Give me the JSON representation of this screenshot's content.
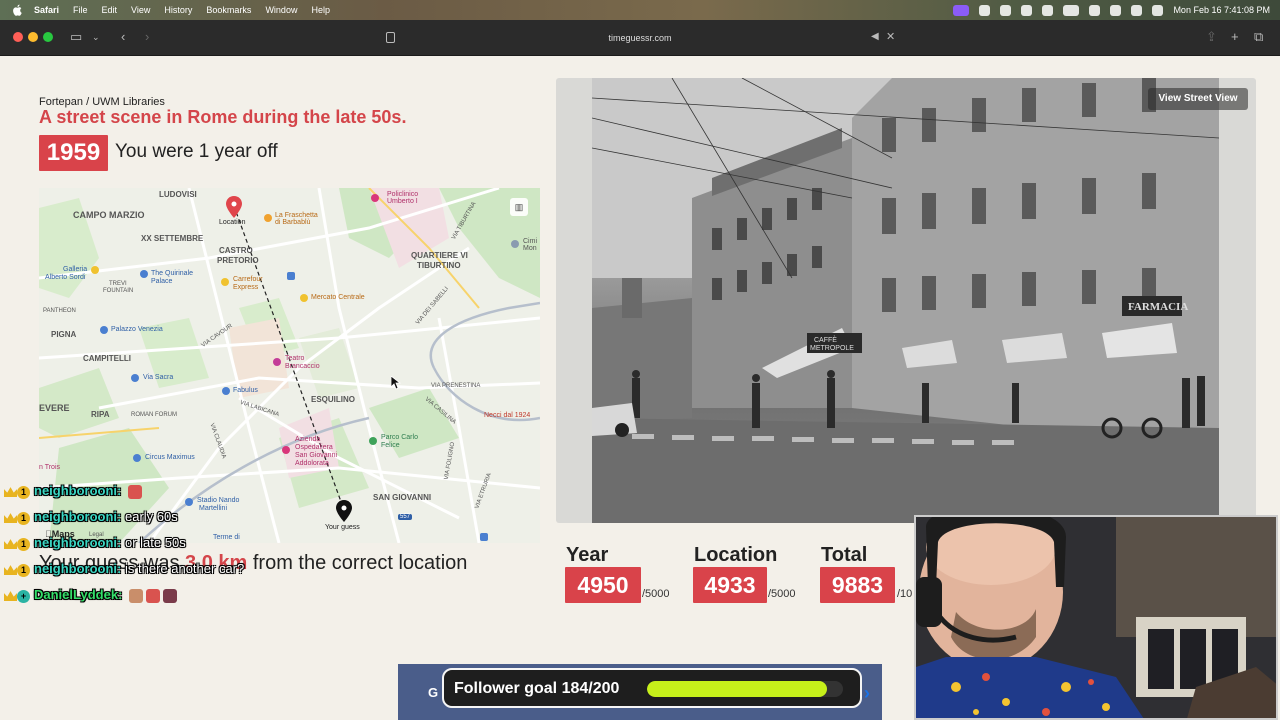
{
  "menubar": {
    "items": [
      "Safari",
      "File",
      "Edit",
      "View",
      "History",
      "Bookmarks",
      "Window",
      "Help"
    ],
    "clock": "Mon Feb 16  7:41:08 PM"
  },
  "browser": {
    "url": "timeguessr.com"
  },
  "result": {
    "credit": "Fortepan / UWM Libraries",
    "description": "A street scene in Rome during the late 50s.",
    "year": "1959",
    "off_text": "You were 1 year off",
    "distance_prefix": "Your guess was",
    "distance_value": "3.0 km",
    "distance_suffix": "from the correct location"
  },
  "map": {
    "labels": {
      "ludovisi": "LUDOVISI",
      "campo_marzio": "CAMPO MARZIO",
      "xx_settembre": "XX SETTEMBRE",
      "castro": "CASTRO",
      "pretorio": "PRETORIO",
      "quartiere": "QUARTIERE VI",
      "tiburtino": "TIBURTINO",
      "galleria1": "Galleria",
      "galleria2": "Alberto Sordi",
      "quirinale1": "The Quirinale",
      "quirinale2": "Palace",
      "trevi1": "TREVI",
      "trevi2": "FOUNTAIN",
      "carrefour1": "Carrefour",
      "carrefour2": "Express",
      "pantheon": "PANTHEON",
      "pigna": "PIGNA",
      "palazzo": "Palazzo Venezia",
      "mercato": "Mercato Centrale",
      "campitelli": "CAMPITELLI",
      "via_sacra": "Via Sacra",
      "fabulus": "Fabulus",
      "teatro1": "Teatro",
      "teatro2": "Brancaccio",
      "esquilino": "ESQUILINO",
      "vere": "EVERE",
      "ripa": "RIPA",
      "roman_forum1": "ROMAN FORUM",
      "circus": "Circus Maximus",
      "azienda1": "Azienda",
      "azienda2": "Ospedaliera",
      "azienda3": "San Giovanni",
      "azienda4": "Addolorata",
      "parco1": "Parco Carlo",
      "parco2": "Felice",
      "san_giovanni": "SAN GIOVANNI",
      "necci": "Necci dal 1924",
      "via_prenestina": "VIA PRENESTINA",
      "via_casilina": "VIA CASILINA",
      "policlinico1": "Policlinico",
      "policlinico2": "Umberto I",
      "fraschetta1": "La Fraschetta",
      "fraschetta2": "di Barbablù",
      "location": "Location",
      "your_guess": "Your guess",
      "trois": "n Trois",
      "stadio1": "Stadio Nando",
      "stadio2": "Martellini",
      "termedi": "Terme di",
      "cimi1": "Cimi",
      "cimi2": "Mon",
      "maps": "Maps",
      "legal": "Legal",
      "via_cavour": "VIA CAVOUR",
      "via_labicana": "VIA LABICANA",
      "via_claudia": "VIA CLAUDIA",
      "via_tiburtina": "VIA TIBURTINA",
      "via_sabelli": "VIA DEI SABELLI",
      "via_foligno": "VIA FOLIGNO",
      "via_etruria": "VIA ETRURIA",
      "route_557": "557"
    }
  },
  "photo": {
    "street_view_label": "View Street View",
    "signs": {
      "farmacia": "FARMACIA",
      "caffe": "CAFFÈ",
      "metropole": "METROPOLE"
    }
  },
  "scores": {
    "year_label": "Year",
    "year_value": "4950",
    "year_max": "/5000",
    "location_label": "Location",
    "location_value": "4933",
    "location_max": "/5000",
    "total_label": "Total",
    "total_value": "9883",
    "total_max": "/10"
  },
  "chat": [
    {
      "name": "neighborooni:",
      "message": ""
    },
    {
      "name": "neighborooni:",
      "message": "early 60s"
    },
    {
      "name": "neighborooni:",
      "message": "or late 50s"
    },
    {
      "name": "neighborooni:",
      "message": "is there another car?"
    },
    {
      "name": "DanielLyddek:",
      "message": ""
    }
  ],
  "stream": {
    "ad_letter": "G",
    "follower_goal_text": "Follower goal 184/200",
    "follower_current": 184,
    "follower_target": 200
  },
  "colors": {
    "accent_red": "#d9434a",
    "goal_fill": "#c6f01a"
  }
}
